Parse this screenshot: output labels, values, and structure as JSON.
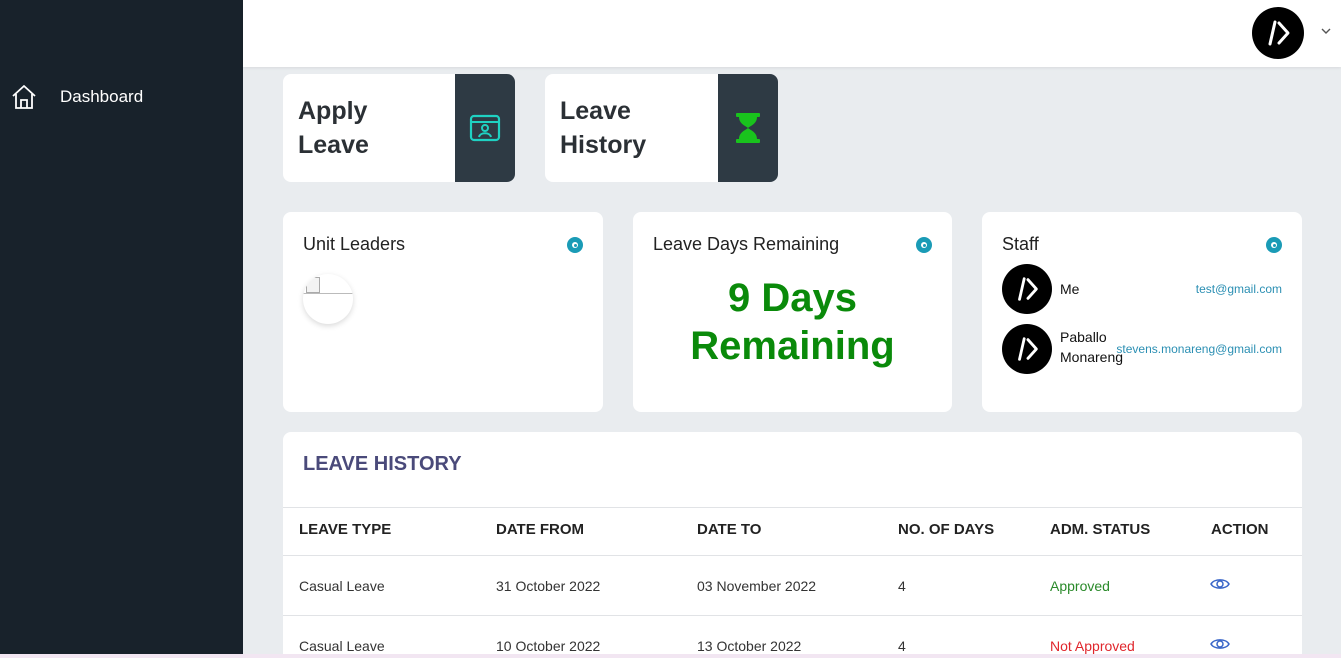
{
  "sidebar": {
    "items": [
      {
        "label": "Dashboard",
        "icon": "home-icon"
      }
    ],
    "bg_color": "#18222b"
  },
  "topbar": {
    "avatar_icon": "code-icon",
    "caret_icon": "chevron-down-icon"
  },
  "action_cards": [
    {
      "label_line1": "Apply",
      "label_line2": "Leave",
      "icon": "id-card-icon",
      "icon_color": "#1fd1c2"
    },
    {
      "label_line1": "Leave",
      "label_line2": "History",
      "icon": "hourglass-icon",
      "icon_color": "#19c31d"
    }
  ],
  "stats": {
    "unit_leaders": {
      "title": "Unit Leaders"
    },
    "leave_days": {
      "title": "Leave Days Remaining",
      "value_line1": "9 Days",
      "value_line2": "Remaining",
      "value_color": "#0a8a0a"
    },
    "staff": {
      "title": "Staff",
      "members": [
        {
          "name_line1": "Me",
          "name_line2": "",
          "email": "test@gmail.com"
        },
        {
          "name_line1": "Paballo",
          "name_line2": "Monareng",
          "email": "stevens.monareng@gmail.com"
        }
      ]
    }
  },
  "history": {
    "title": "LEAVE HISTORY",
    "columns": [
      "LEAVE TYPE",
      "DATE FROM",
      "DATE TO",
      "NO. OF DAYS",
      "ADM. STATUS",
      "ACTION"
    ],
    "rows": [
      {
        "type": "Casual Leave",
        "from": "31 October 2022",
        "to": "03 November 2022",
        "days": "4",
        "status": "Approved",
        "action_icon": "eye-icon"
      },
      {
        "type": "Casual Leave",
        "from": "10 October 2022",
        "to": "13 October 2022",
        "days": "4",
        "status": "Not Approved",
        "action_icon": "eye-icon"
      }
    ],
    "status_colors": {
      "approved": "#2a8a2a",
      "not_approved": "#e0262c"
    }
  }
}
